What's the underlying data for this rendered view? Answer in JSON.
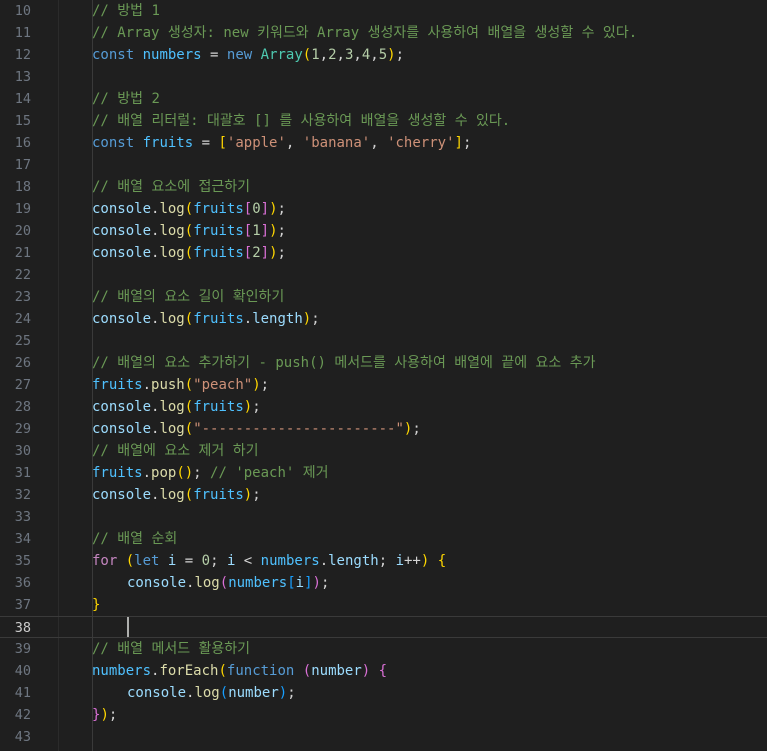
{
  "editor": {
    "active_line": 38,
    "lines": [
      {
        "n": "10",
        "indent": 1,
        "t": [
          [
            "comment",
            "// 방법 1"
          ]
        ]
      },
      {
        "n": "11",
        "indent": 1,
        "t": [
          [
            "comment",
            "// Array 생성자: new 키워드와 Array 생성자를 사용하여 배열을 생성할 수 있다."
          ]
        ]
      },
      {
        "n": "12",
        "indent": 1,
        "t": [
          [
            "keyword",
            "const"
          ],
          [
            "punc",
            " "
          ],
          [
            "const",
            "numbers"
          ],
          [
            "punc",
            " = "
          ],
          [
            "keyword",
            "new"
          ],
          [
            "punc",
            " "
          ],
          [
            "class",
            "Array"
          ],
          [
            "br1",
            "("
          ],
          [
            "num",
            "1"
          ],
          [
            "punc",
            ","
          ],
          [
            "num",
            "2"
          ],
          [
            "punc",
            ","
          ],
          [
            "num",
            "3"
          ],
          [
            "punc",
            ","
          ],
          [
            "num",
            "4"
          ],
          [
            "punc",
            ","
          ],
          [
            "num",
            "5"
          ],
          [
            "br1",
            ")"
          ],
          [
            "punc",
            ";"
          ]
        ]
      },
      {
        "n": "13",
        "indent": 1,
        "t": []
      },
      {
        "n": "14",
        "indent": 1,
        "t": [
          [
            "comment",
            "// 방법 2"
          ]
        ]
      },
      {
        "n": "15",
        "indent": 1,
        "t": [
          [
            "comment",
            "// 배열 리터럴: 대괄호 [] 를 사용하여 배열을 생성할 수 있다."
          ]
        ]
      },
      {
        "n": "16",
        "indent": 1,
        "t": [
          [
            "keyword",
            "const"
          ],
          [
            "punc",
            " "
          ],
          [
            "const",
            "fruits"
          ],
          [
            "punc",
            " = "
          ],
          [
            "br1",
            "["
          ],
          [
            "str",
            "'apple'"
          ],
          [
            "punc",
            ", "
          ],
          [
            "str",
            "'banana'"
          ],
          [
            "punc",
            ", "
          ],
          [
            "str",
            "'cherry'"
          ],
          [
            "br1",
            "]"
          ],
          [
            "punc",
            ";"
          ]
        ]
      },
      {
        "n": "17",
        "indent": 1,
        "t": []
      },
      {
        "n": "18",
        "indent": 1,
        "t": [
          [
            "comment",
            "// 배열 요소에 접근하기"
          ]
        ]
      },
      {
        "n": "19",
        "indent": 1,
        "t": [
          [
            "var",
            "console"
          ],
          [
            "punc",
            "."
          ],
          [
            "func",
            "log"
          ],
          [
            "br1",
            "("
          ],
          [
            "const",
            "fruits"
          ],
          [
            "br2",
            "["
          ],
          [
            "num",
            "0"
          ],
          [
            "br2",
            "]"
          ],
          [
            "br1",
            ")"
          ],
          [
            "punc",
            ";"
          ]
        ]
      },
      {
        "n": "20",
        "indent": 1,
        "t": [
          [
            "var",
            "console"
          ],
          [
            "punc",
            "."
          ],
          [
            "func",
            "log"
          ],
          [
            "br1",
            "("
          ],
          [
            "const",
            "fruits"
          ],
          [
            "br2",
            "["
          ],
          [
            "num",
            "1"
          ],
          [
            "br2",
            "]"
          ],
          [
            "br1",
            ")"
          ],
          [
            "punc",
            ";"
          ]
        ]
      },
      {
        "n": "21",
        "indent": 1,
        "t": [
          [
            "var",
            "console"
          ],
          [
            "punc",
            "."
          ],
          [
            "func",
            "log"
          ],
          [
            "br1",
            "("
          ],
          [
            "const",
            "fruits"
          ],
          [
            "br2",
            "["
          ],
          [
            "num",
            "2"
          ],
          [
            "br2",
            "]"
          ],
          [
            "br1",
            ")"
          ],
          [
            "punc",
            ";"
          ]
        ]
      },
      {
        "n": "22",
        "indent": 1,
        "t": []
      },
      {
        "n": "23",
        "indent": 1,
        "t": [
          [
            "comment",
            "// 배열의 요소 길이 확인하기"
          ]
        ]
      },
      {
        "n": "24",
        "indent": 1,
        "t": [
          [
            "var",
            "console"
          ],
          [
            "punc",
            "."
          ],
          [
            "func",
            "log"
          ],
          [
            "br1",
            "("
          ],
          [
            "const",
            "fruits"
          ],
          [
            "punc",
            "."
          ],
          [
            "var",
            "length"
          ],
          [
            "br1",
            ")"
          ],
          [
            "punc",
            ";"
          ]
        ]
      },
      {
        "n": "25",
        "indent": 1,
        "t": []
      },
      {
        "n": "26",
        "indent": 1,
        "t": [
          [
            "comment",
            "// 배열의 요소 추가하기 - push() 메서드를 사용하여 배열에 끝에 요소 추가"
          ]
        ]
      },
      {
        "n": "27",
        "indent": 1,
        "t": [
          [
            "const",
            "fruits"
          ],
          [
            "punc",
            "."
          ],
          [
            "func",
            "push"
          ],
          [
            "br1",
            "("
          ],
          [
            "str",
            "\"peach\""
          ],
          [
            "br1",
            ")"
          ],
          [
            "punc",
            ";"
          ]
        ]
      },
      {
        "n": "28",
        "indent": 1,
        "t": [
          [
            "var",
            "console"
          ],
          [
            "punc",
            "."
          ],
          [
            "func",
            "log"
          ],
          [
            "br1",
            "("
          ],
          [
            "const",
            "fruits"
          ],
          [
            "br1",
            ")"
          ],
          [
            "punc",
            ";"
          ]
        ]
      },
      {
        "n": "29",
        "indent": 1,
        "t": [
          [
            "var",
            "console"
          ],
          [
            "punc",
            "."
          ],
          [
            "func",
            "log"
          ],
          [
            "br1",
            "("
          ],
          [
            "str",
            "\"-----------------------\""
          ],
          [
            "br1",
            ")"
          ],
          [
            "punc",
            ";"
          ]
        ]
      },
      {
        "n": "30",
        "indent": 1,
        "t": [
          [
            "comment",
            "// 배열에 요소 제거 하기"
          ]
        ]
      },
      {
        "n": "31",
        "indent": 1,
        "t": [
          [
            "const",
            "fruits"
          ],
          [
            "punc",
            "."
          ],
          [
            "func",
            "pop"
          ],
          [
            "br1",
            "()"
          ],
          [
            "punc",
            "; "
          ],
          [
            "comment",
            "// 'peach' 제거"
          ]
        ]
      },
      {
        "n": "32",
        "indent": 1,
        "t": [
          [
            "var",
            "console"
          ],
          [
            "punc",
            "."
          ],
          [
            "func",
            "log"
          ],
          [
            "br1",
            "("
          ],
          [
            "const",
            "fruits"
          ],
          [
            "br1",
            ")"
          ],
          [
            "punc",
            ";"
          ]
        ]
      },
      {
        "n": "33",
        "indent": 1,
        "t": []
      },
      {
        "n": "34",
        "indent": 1,
        "t": [
          [
            "comment",
            "// 배열 순회"
          ]
        ]
      },
      {
        "n": "35",
        "indent": 1,
        "t": [
          [
            "control",
            "for"
          ],
          [
            "punc",
            " "
          ],
          [
            "br1",
            "("
          ],
          [
            "keyword",
            "let"
          ],
          [
            "punc",
            " "
          ],
          [
            "var",
            "i"
          ],
          [
            "punc",
            " = "
          ],
          [
            "num",
            "0"
          ],
          [
            "punc",
            "; "
          ],
          [
            "var",
            "i"
          ],
          [
            "punc",
            " < "
          ],
          [
            "const",
            "numbers"
          ],
          [
            "punc",
            "."
          ],
          [
            "var",
            "length"
          ],
          [
            "punc",
            "; "
          ],
          [
            "var",
            "i"
          ],
          [
            "punc",
            "++"
          ],
          [
            "br1",
            ")"
          ],
          [
            "punc",
            " "
          ],
          [
            "br1",
            "{"
          ]
        ]
      },
      {
        "n": "36",
        "indent": 2,
        "t": [
          [
            "var",
            "console"
          ],
          [
            "punc",
            "."
          ],
          [
            "func",
            "log"
          ],
          [
            "br2",
            "("
          ],
          [
            "const",
            "numbers"
          ],
          [
            "br3",
            "["
          ],
          [
            "var",
            "i"
          ],
          [
            "br3",
            "]"
          ],
          [
            "br2",
            ")"
          ],
          [
            "punc",
            ";"
          ]
        ]
      },
      {
        "n": "37",
        "indent": 1,
        "t": [
          [
            "br1",
            "}"
          ]
        ]
      },
      {
        "n": "38",
        "indent": 1,
        "t": []
      },
      {
        "n": "39",
        "indent": 1,
        "t": [
          [
            "comment",
            "// 배열 메서드 활용하기"
          ]
        ]
      },
      {
        "n": "40",
        "indent": 1,
        "t": [
          [
            "const",
            "numbers"
          ],
          [
            "punc",
            "."
          ],
          [
            "func",
            "forEach"
          ],
          [
            "br1",
            "("
          ],
          [
            "keyword",
            "function"
          ],
          [
            "punc",
            " "
          ],
          [
            "br2",
            "("
          ],
          [
            "var",
            "number"
          ],
          [
            "br2",
            ")"
          ],
          [
            "punc",
            " "
          ],
          [
            "br2",
            "{"
          ]
        ]
      },
      {
        "n": "41",
        "indent": 2,
        "t": [
          [
            "var",
            "console"
          ],
          [
            "punc",
            "."
          ],
          [
            "func",
            "log"
          ],
          [
            "br3",
            "("
          ],
          [
            "var",
            "number"
          ],
          [
            "br3",
            ")"
          ],
          [
            "punc",
            ";"
          ]
        ]
      },
      {
        "n": "42",
        "indent": 1,
        "t": [
          [
            "br2",
            "}"
          ],
          [
            "br1",
            ")"
          ],
          [
            "punc",
            ";"
          ]
        ]
      },
      {
        "n": "43",
        "indent": 1,
        "t": []
      }
    ]
  }
}
